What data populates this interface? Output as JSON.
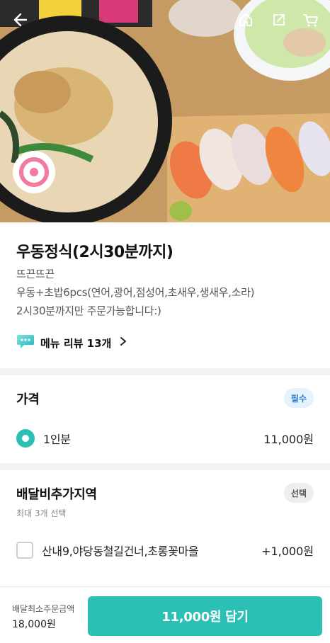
{
  "header": {
    "icons": [
      "back-arrow-icon",
      "home-icon",
      "share-icon",
      "cart-icon"
    ]
  },
  "menu": {
    "title": "우동정식(2시30분까지)",
    "description": [
      "뜨끈뜨끈",
      "우동+초밥6pcs(연어,광어,점성어,초새우,생새우,소라)",
      "2시30분까지만 주문가능합니다:)"
    ],
    "review_label": "메뉴 리뷰 13개"
  },
  "price_section": {
    "title": "가격",
    "badge": "필수",
    "options": [
      {
        "label": "1인분",
        "price": "11,000원",
        "selected": true
      }
    ]
  },
  "delivery_section": {
    "title": "배달비추가지역",
    "badge": "선택",
    "subtitle": "최대 3개 선택",
    "options": [
      {
        "label": "산내9,야당동철길건너,초롱꽃마을",
        "price": "+1,000원",
        "checked": false
      }
    ]
  },
  "bottom_bar": {
    "min_order_label": "배달최소주문금액",
    "min_order_value": "18,000원",
    "cta_label": "11,000원 담기"
  },
  "colors": {
    "accent": "#2bbfb6",
    "required_badge_bg": "#e6f2fb",
    "required_badge_text": "#2f7fd6"
  }
}
